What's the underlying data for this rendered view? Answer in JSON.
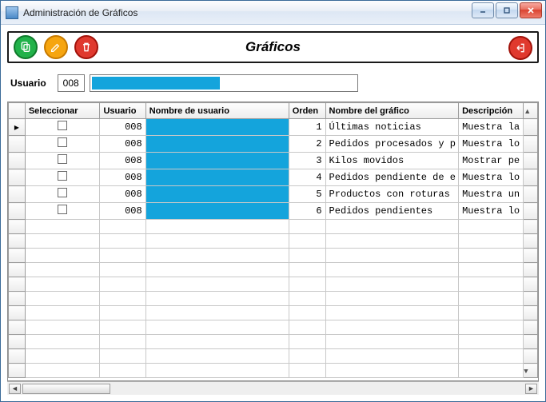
{
  "window": {
    "title": "Administración de Gráficos"
  },
  "toolbar": {
    "heading": "Gráficos",
    "copy_icon": "copy",
    "edit_icon": "pencil",
    "delete_icon": "trash",
    "exit_icon": "power"
  },
  "filter": {
    "label": "Usuario",
    "code": "008",
    "name_redacted": true
  },
  "columns": {
    "sel": "Seleccionar",
    "usr": "Usuario",
    "nusr": "Nombre de usuario",
    "ord": "Orden",
    "ngraf": "Nombre del gráfico",
    "desc": "Descripción"
  },
  "rows": [
    {
      "usr": "008",
      "ord": 1,
      "ngraf": "Últimas noticias",
      "desc": "Muestra la"
    },
    {
      "usr": "008",
      "ord": 2,
      "ngraf": "Pedidos procesados y p",
      "desc": "Muestra lo"
    },
    {
      "usr": "008",
      "ord": 3,
      "ngraf": "Kilos movidos",
      "desc": "Mostrar pe"
    },
    {
      "usr": "008",
      "ord": 4,
      "ngraf": "Pedidos pendiente de e",
      "desc": "Muestra lo"
    },
    {
      "usr": "008",
      "ord": 5,
      "ngraf": "Productos con roturas",
      "desc": "Muestra un"
    },
    {
      "usr": "008",
      "ord": 6,
      "ngraf": "Pedidos pendientes",
      "desc": "Muestra lo"
    }
  ],
  "empty_rows": 11
}
